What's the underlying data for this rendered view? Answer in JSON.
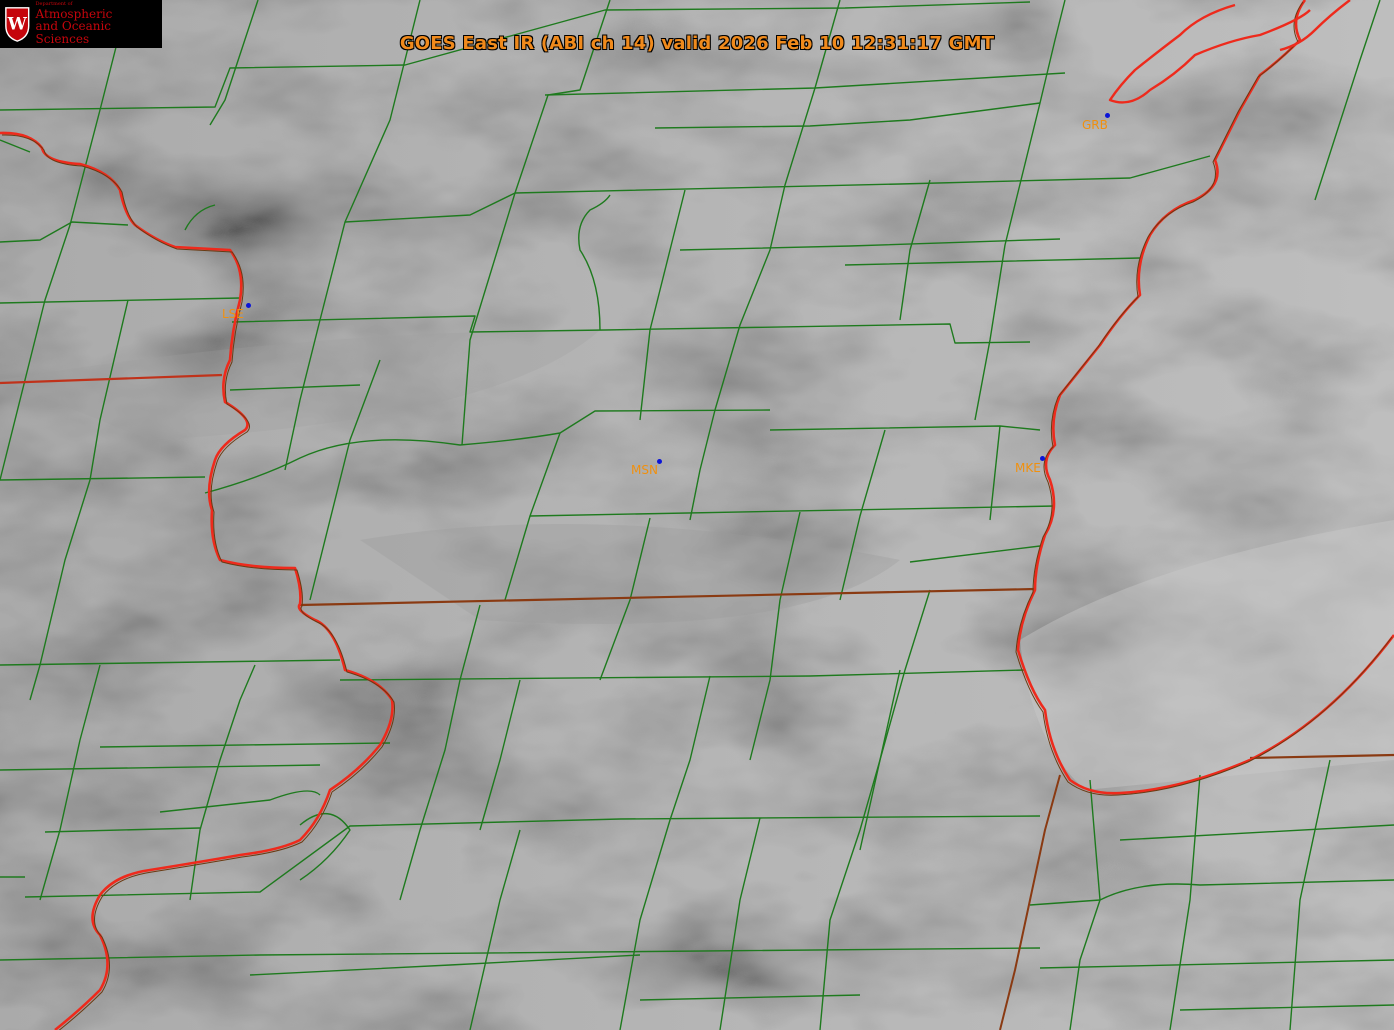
{
  "title": "GOES East IR (ABI ch 14) valid 2026 Feb 10 12:31:17 GMT",
  "logo": {
    "dept_line": "Department of",
    "line1": "Atmospheric",
    "line2": "and Oceanic Sciences",
    "emblem": "W"
  },
  "stations": [
    {
      "id": "LSE",
      "label": "LSE"
    },
    {
      "id": "MSN",
      "label": "MSN"
    },
    {
      "id": "MKE",
      "label": "MKE"
    },
    {
      "id": "GRB",
      "label": "GRB"
    }
  ],
  "colors": {
    "title": "#f08a1c",
    "station_label": "#f0900f",
    "station_dot": "#0a14d8",
    "county_lines": "#1e7a1e",
    "state_lines": "#e8261a",
    "logo_bg": "#000000",
    "logo_text": "#c5050c"
  }
}
